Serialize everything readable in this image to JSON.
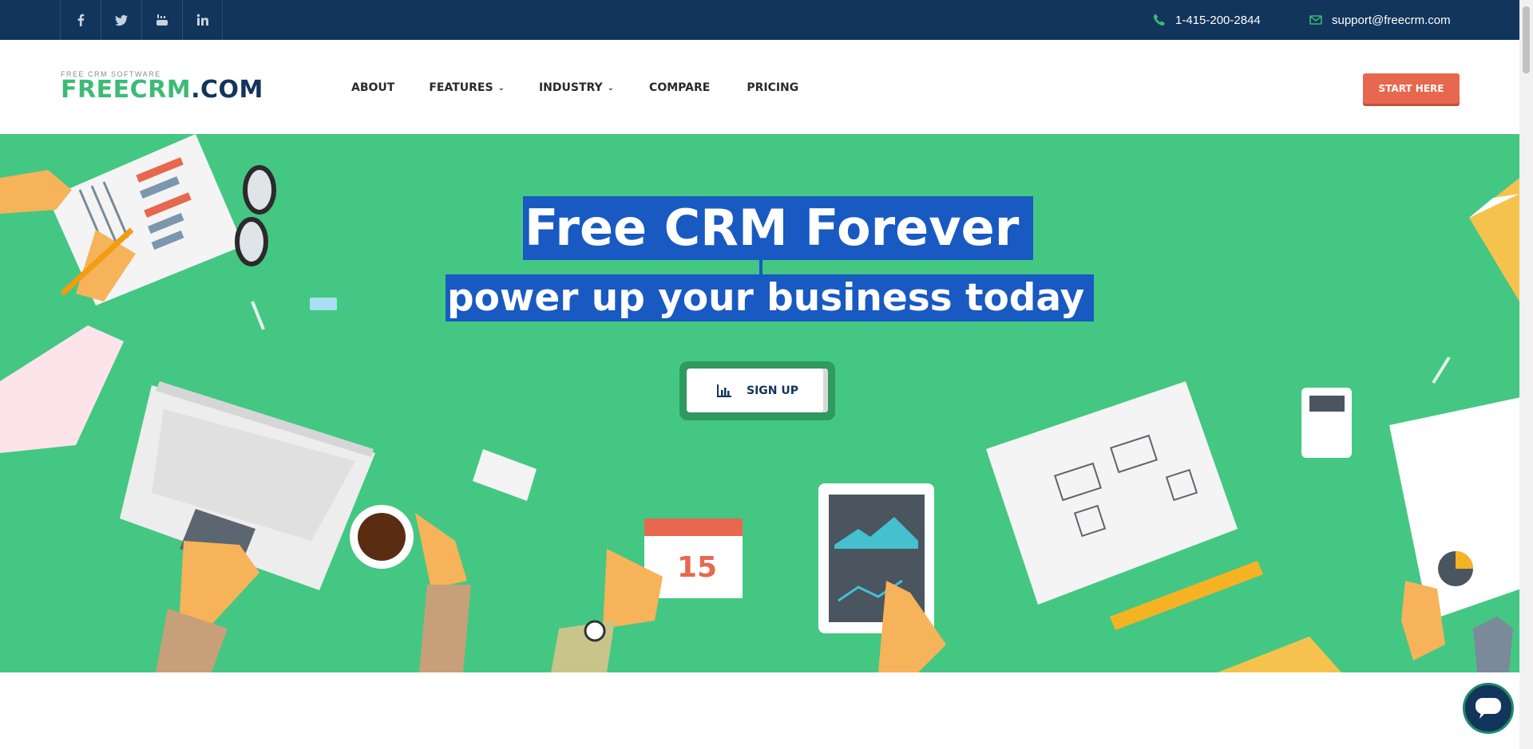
{
  "topbar": {
    "social": [
      {
        "name": "facebook-icon",
        "glyph": "f"
      },
      {
        "name": "twitter-icon",
        "glyph": "t"
      },
      {
        "name": "youtube-icon",
        "glyph": "y"
      },
      {
        "name": "linkedin-icon",
        "glyph": "in"
      }
    ],
    "phone": "1-415-200-2844",
    "email": "support@freecrm.com"
  },
  "header": {
    "logo_sub": "FREE CRM SOFTWARE",
    "logo_green": "FREECRM",
    "logo_navy": ".COM",
    "nav": [
      {
        "label": "ABOUT",
        "dropdown": false
      },
      {
        "label": "FEATURES",
        "dropdown": true
      },
      {
        "label": "INDUSTRY",
        "dropdown": true
      },
      {
        "label": "COMPARE",
        "dropdown": false
      },
      {
        "label": "PRICING",
        "dropdown": false
      }
    ],
    "cta": "START HERE"
  },
  "hero": {
    "headline": "Free CRM Forever",
    "subline": "power up your business today",
    "signup": "SIGN UP",
    "calendar_day": "15"
  },
  "colors": {
    "topbar_bg": "#12355b",
    "hero_green": "#44c783",
    "highlight": "#1959c2",
    "cta": "#e8674f",
    "logo_green": "#3dbb76"
  }
}
